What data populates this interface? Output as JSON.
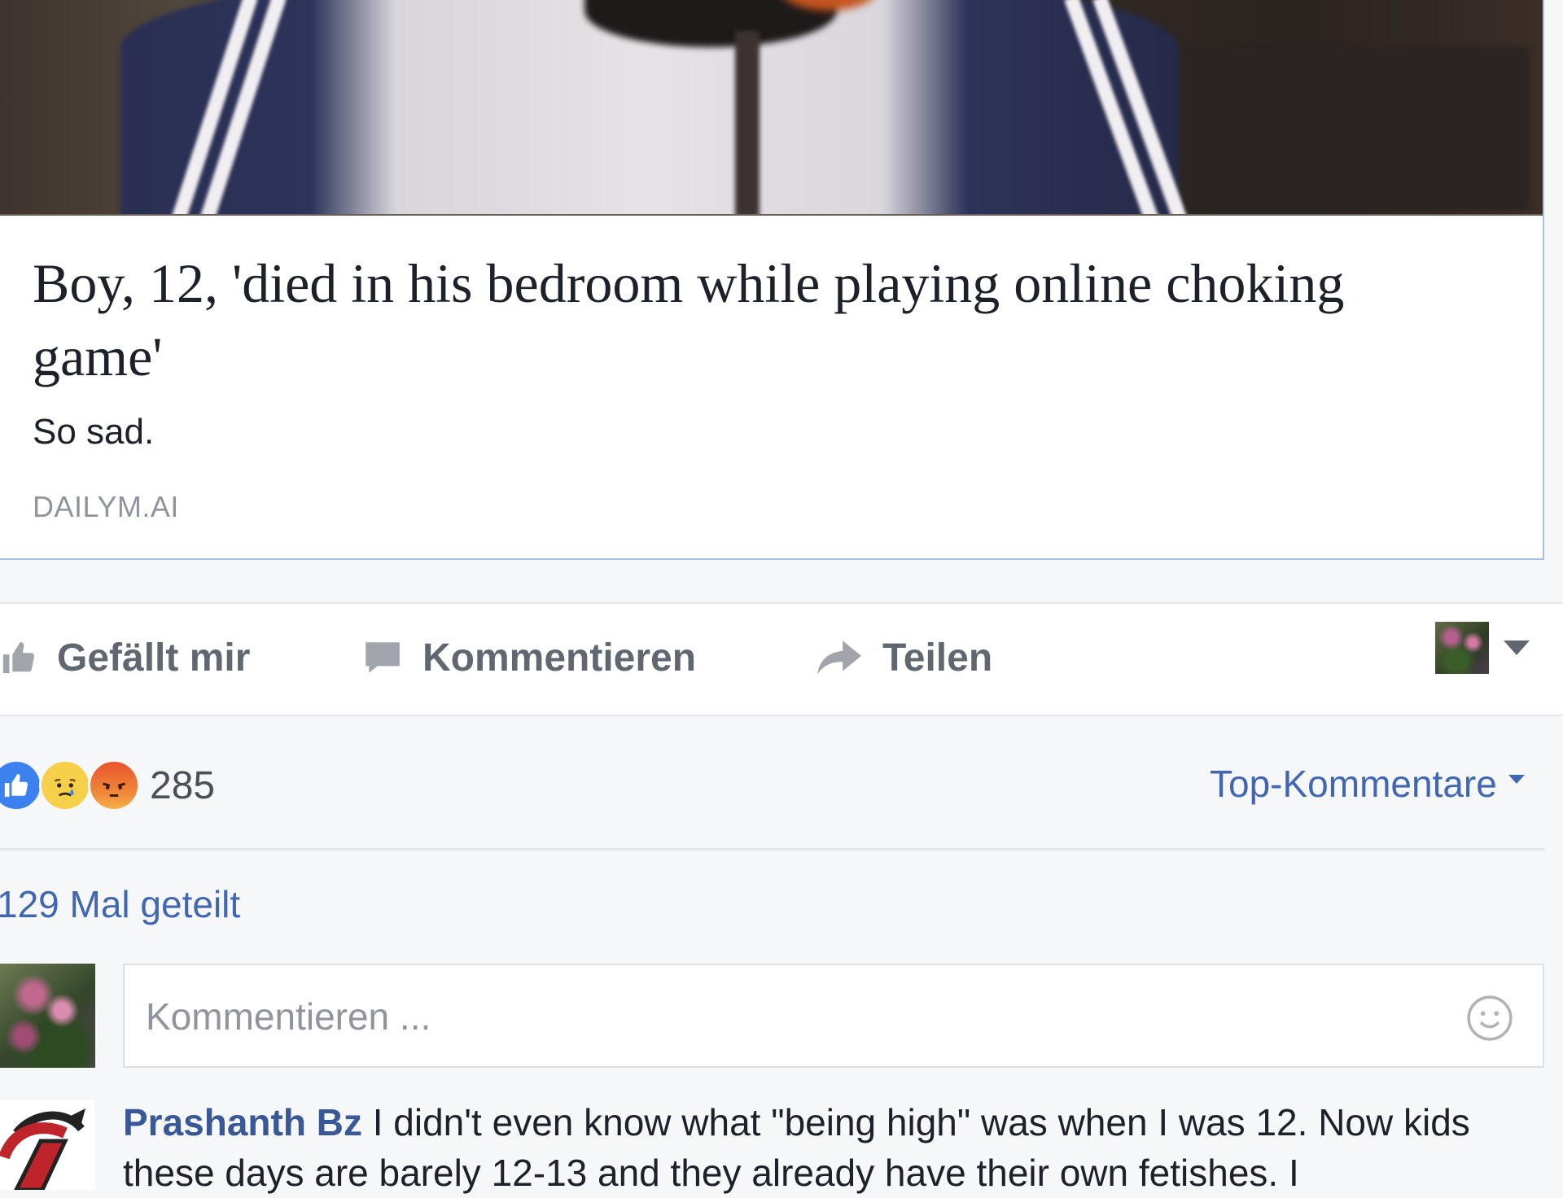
{
  "link_preview": {
    "headline": "Boy, 12, 'died in his bedroom while playing online choking game'",
    "subtitle": "So sad.",
    "domain": "DAILYM.AI"
  },
  "actions": {
    "like_label": "Gefällt mir",
    "comment_label": "Kommentieren",
    "share_label": "Teilen"
  },
  "reactions": {
    "types": [
      "like",
      "sad",
      "angry"
    ],
    "count": "285"
  },
  "sort": {
    "label": "Top-Kommentare"
  },
  "shares": {
    "label": "129 Mal geteilt"
  },
  "composer": {
    "placeholder": "Kommentieren ..."
  },
  "comment": {
    "author": "Prashanth Bz",
    "text": " I didn't even know what \"being high\" was when I was 12. Now kids these days are barely 12-13 and they already have their own fetishes. I"
  },
  "colors": {
    "link_blue": "#4267b2",
    "author_blue": "#385898",
    "action_gray": "#606770",
    "like_blue": "#3b82f0",
    "sad_yellow": "#f7d04a",
    "angry_orange": "#e9542c"
  }
}
